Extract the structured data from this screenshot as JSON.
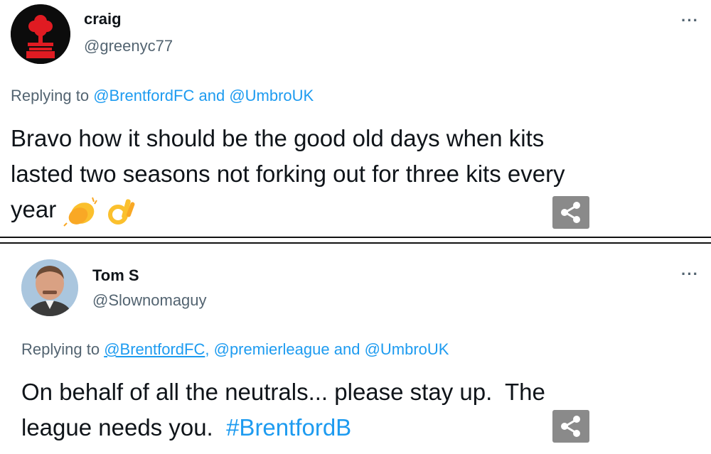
{
  "tweets": [
    {
      "name": "craig",
      "handle": "@greenyc77",
      "more": "···",
      "replying_prefix": "Replying to",
      "mentions": [
        "@BrentfordFC",
        "and",
        "@UmbroUK"
      ],
      "text_line1": "Bravo how it should be the good old days when kits",
      "text_line2": "lasted two seasons not forking out for three kits every",
      "text_line3": "year",
      "emojis": [
        "clapping-hands-emoji",
        "ok-hand-emoji"
      ],
      "avatar": "forest-tree-crest-icon"
    },
    {
      "name": "Tom S",
      "handle": "@Slownomaguy",
      "more": "···",
      "replying_prefix": "Replying to",
      "mentions": [
        "@BrentfordFC",
        ",",
        "@premierleague",
        "and",
        "@UmbroUK"
      ],
      "text_line1": "On behalf of all the neutrals... please stay up.  The",
      "text_line2_prefix": "league needs you.",
      "hashtag": "#BrentfordB",
      "avatar": "man-portrait-icon"
    }
  ],
  "colors": {
    "link": "#1d9bf0",
    "secondary": "#536471",
    "text": "#0f1419",
    "share_bg": "#8a8a8a"
  },
  "icons": {
    "share": "share-icon"
  }
}
